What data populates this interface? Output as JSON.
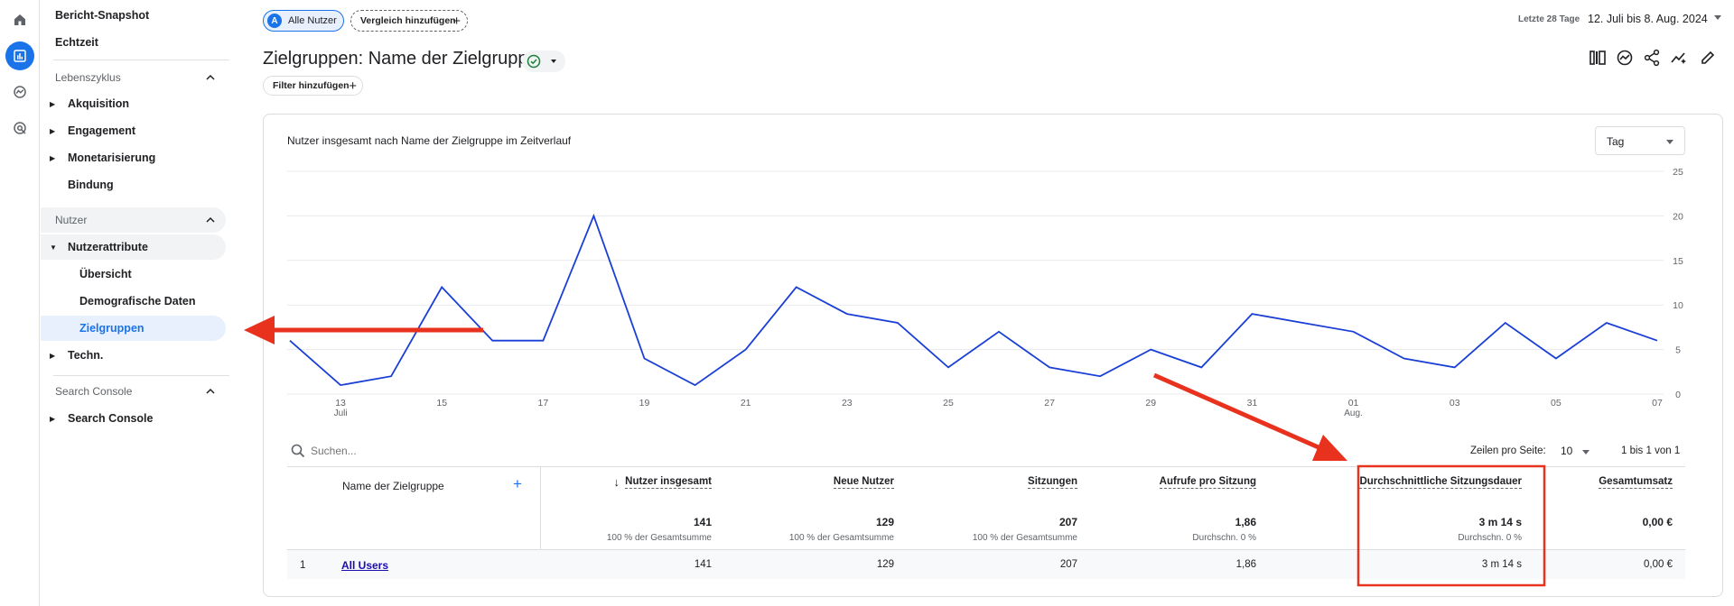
{
  "header": {
    "segment_chip": {
      "badge": "A",
      "label": "Alle Nutzer"
    },
    "compare_chip": "Vergleich hinzufügen",
    "date_range_label": "Letzte 28 Tage",
    "date_range": "12. Juli bis 8. Aug. 2024"
  },
  "title": "Zielgruppen: Name der Zielgruppe",
  "filter_chip": "Filter hinzufügen",
  "sidebar": {
    "top": [
      "Bericht-Snapshot",
      "Echtzeit"
    ],
    "lifecycle": {
      "label": "Lebenszyklus",
      "items": [
        "Akquisition",
        "Engagement",
        "Monetarisierung",
        "Bindung"
      ]
    },
    "user": {
      "label": "Nutzer",
      "group": "Nutzerattribute",
      "items": [
        "Übersicht",
        "Demografische Daten",
        "Zielgruppen"
      ],
      "tech": "Techn."
    },
    "search_console": {
      "label": "Search Console",
      "item": "Search Console"
    }
  },
  "card": {
    "chart_title": "Nutzer insgesamt nach Name der Zielgruppe im Zeitverlauf",
    "granularity": "Tag",
    "search_placeholder": "Suchen...",
    "rows_per_page_label": "Zeilen pro Seite:",
    "rows_per_page": "10",
    "pagination": "1 bis 1 von 1"
  },
  "table": {
    "dimension_header": "Name der Zielgruppe",
    "columns": [
      {
        "header": "Nutzer insgesamt",
        "total": "141",
        "sub": "100 % der Gesamtsumme",
        "row": "141"
      },
      {
        "header": "Neue Nutzer",
        "total": "129",
        "sub": "100 % der Gesamtsumme",
        "row": "129"
      },
      {
        "header": "Sitzungen",
        "total": "207",
        "sub": "100 % der Gesamtsumme",
        "row": "207"
      },
      {
        "header": "Aufrufe pro Sitzung",
        "total": "1,86",
        "sub": "Durchschn. 0 %",
        "row": "1,86"
      },
      {
        "header": "Durchschnittliche Sitzungsdauer",
        "total": "3 m 14 s",
        "sub": "Durchschn. 0 %",
        "row": "3 m 14 s"
      },
      {
        "header": "Gesamtumsatz",
        "total": "0,00 €",
        "sub": "",
        "row": "0,00 €"
      }
    ],
    "rows": [
      {
        "index": "1",
        "name": "All Users"
      }
    ]
  },
  "chart_data": {
    "type": "line",
    "title": "Nutzer insgesamt nach Name der Zielgruppe im Zeitverlauf",
    "x": [
      "12 Jul",
      "13 Jul",
      "14 Jul",
      "15 Jul",
      "16 Jul",
      "17 Jul",
      "18 Jul",
      "19 Jul",
      "20 Jul",
      "21 Jul",
      "22 Jul",
      "23 Jul",
      "24 Jul",
      "25 Jul",
      "26 Jul",
      "27 Jul",
      "28 Jul",
      "29 Jul",
      "30 Jul",
      "31 Jul",
      "01 Aug",
      "02 Aug",
      "03 Aug",
      "04 Aug",
      "05 Aug",
      "06 Aug",
      "07 Aug",
      "08 Aug"
    ],
    "series": [
      {
        "values": [
          6,
          1,
          2,
          12,
          6,
          6,
          20,
          4,
          1,
          5,
          12,
          9,
          8,
          3,
          7,
          3,
          2,
          5,
          3,
          9,
          8,
          7,
          4,
          3,
          8,
          4,
          8,
          6
        ]
      }
    ],
    "ylim": [
      0,
      25
    ],
    "yticks": [
      "25",
      "20",
      "15",
      "10",
      "5",
      "0"
    ],
    "xtick_labels": [
      {
        "day": "13",
        "month": "Juli"
      },
      {
        "day": "15",
        "month": ""
      },
      {
        "day": "17",
        "month": ""
      },
      {
        "day": "19",
        "month": ""
      },
      {
        "day": "21",
        "month": ""
      },
      {
        "day": "23",
        "month": ""
      },
      {
        "day": "25",
        "month": ""
      },
      {
        "day": "27",
        "month": ""
      },
      {
        "day": "29",
        "month": ""
      },
      {
        "day": "31",
        "month": ""
      },
      {
        "day": "01",
        "month": "Aug."
      },
      {
        "day": "03",
        "month": ""
      },
      {
        "day": "05",
        "month": ""
      },
      {
        "day": "07",
        "month": ""
      }
    ],
    "line_color": "#1a3fd6",
    "grid": true
  },
  "annotations_color": "#e8321e"
}
